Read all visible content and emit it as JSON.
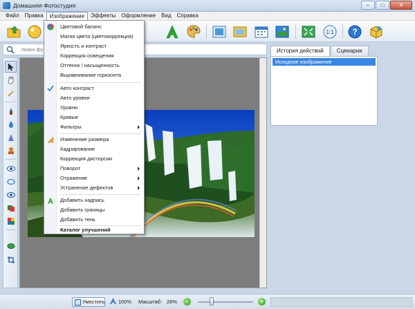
{
  "window": {
    "title": "Домашняя Фотостудия",
    "controls": [
      "–",
      "□",
      "✕"
    ]
  },
  "menubar": {
    "items": [
      "Файл",
      "Правка",
      "Изображение",
      "Эффекты",
      "Оформление",
      "Вид",
      "Справка"
    ],
    "open_item": "Изображение"
  },
  "toolbar": {
    "icons": [
      "open-folder-icon",
      "magic-ball-icon",
      "add-text-icon",
      "palette-icon",
      "frames-icon",
      "card-icon",
      "calendar-icon",
      "collage-icon",
      "fit-window-icon",
      "actual-size-icon",
      "help-icon",
      "box-icon"
    ]
  },
  "search": {
    "placeholder": "поиск функций"
  },
  "right_panel": {
    "tabs": [
      "История действий",
      "Сценарии"
    ],
    "active_tab": "История действий",
    "history_items": [
      "Исходное изображение"
    ]
  },
  "image_menu": {
    "items": [
      {
        "label": "Цветовой баланс",
        "icon": "color-balance-icon"
      },
      {
        "label": "Магия цвета (цветокоррекция)"
      },
      {
        "label": "Яркость и контраст"
      },
      {
        "label": "Коррекция освещения"
      },
      {
        "label": "Оттенок / насыщенность"
      },
      {
        "label": "Выравнивание горизонта"
      },
      {
        "label": "Авто контраст",
        "icon": "checkmark-icon"
      },
      {
        "label": "Авто уровни"
      },
      {
        "label": "Уровни"
      },
      {
        "label": "Кривые"
      },
      {
        "label": "Фильтры",
        "submenu": true
      },
      {
        "label": "Изменение размера",
        "icon": "resize-icon"
      },
      {
        "label": "Кадрирование"
      },
      {
        "label": "Коррекция дисторсии"
      },
      {
        "label": "Поворот",
        "submenu": true
      },
      {
        "label": "Отражение",
        "submenu": true
      },
      {
        "label": "Устранение дефектов",
        "submenu": true
      },
      {
        "label": "Добавить надпись",
        "icon": "text-a-icon"
      },
      {
        "label": "Добавить границы"
      },
      {
        "label": "Добавить тень"
      },
      {
        "label": "Каталог улучшений",
        "bold": true
      }
    ]
  },
  "statusbar": {
    "fit_label": "Уместить",
    "zoom_100": "100%",
    "scale_label": "Масштаб:",
    "scale_value": "28%",
    "zoom_minus": "–",
    "zoom_plus": "+",
    "zoom_slider_fraction": 0.25
  }
}
